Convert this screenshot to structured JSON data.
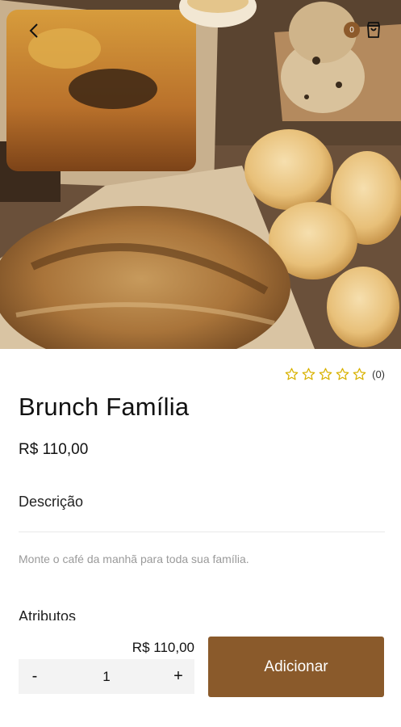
{
  "header": {
    "back_icon": "chevron-left-icon",
    "cart_icon": "shopping-bag-icon",
    "cart_count": "0"
  },
  "product": {
    "name": "Brunch Família",
    "price": "R$ 110,00",
    "rating_value": 0,
    "rating_max": 5,
    "rating_count": "(0)",
    "star_color": "#d9b200"
  },
  "description": {
    "label": "Descrição",
    "text": "Monte o café da manhã para toda sua família."
  },
  "attributes": {
    "label": "Atributos"
  },
  "order": {
    "subtotal": "R$ 110,00",
    "minus_label": "-",
    "quantity": "1",
    "plus_label": "+",
    "add_label": "Adicionar",
    "accent_color": "#8a5a2b"
  }
}
